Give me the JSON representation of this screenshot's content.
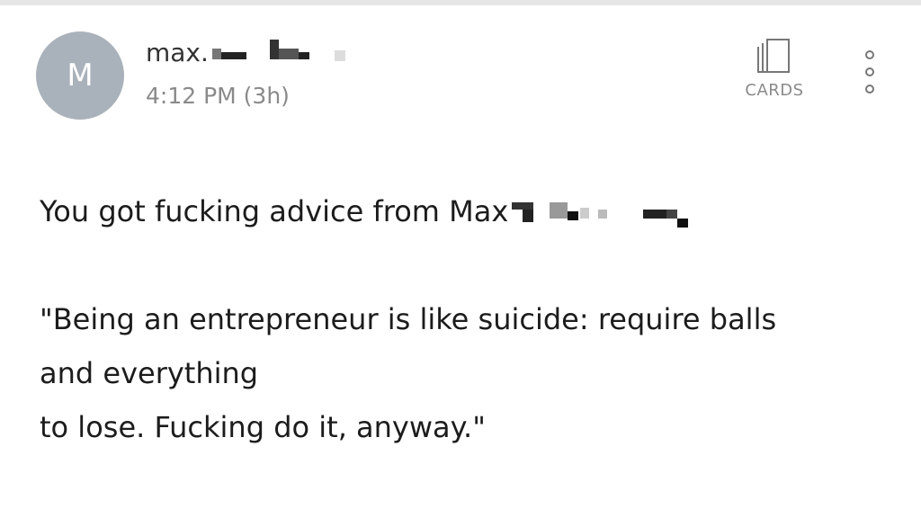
{
  "avatar": {
    "initial": "M"
  },
  "sender": {
    "name_prefix": "max."
  },
  "meta": {
    "time": "4:12 PM (3h)"
  },
  "actions": {
    "cards_label": "CARDS",
    "cards_icon": "cards-icon",
    "more_icon": "more-vertical-icon"
  },
  "message": {
    "line1": "You got fucking advice from Max",
    "line2": "\"Being an entrepreneur is like suicide: require balls",
    "line3": "and everything",
    "line4": "to lose. Fucking do it, anyway.\""
  },
  "colors": {
    "avatar_bg": "#a9b1ba",
    "secondary_text": "#8a8a8a",
    "body_text": "#1c1c1c"
  }
}
